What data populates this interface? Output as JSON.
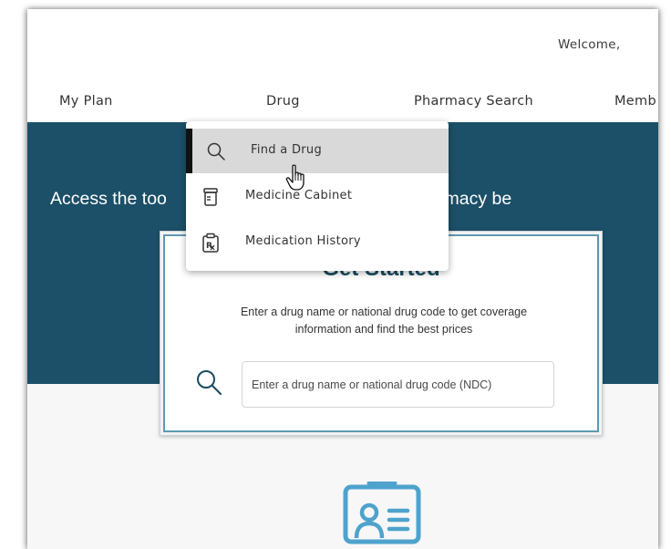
{
  "header": {
    "welcome_text": "Welcome,"
  },
  "nav": {
    "items": [
      "My Plan",
      "Drug",
      "Pharmacy Search",
      "Memb"
    ]
  },
  "dropdown": {
    "items": [
      {
        "label": "Find a Drug",
        "icon": "search-icon",
        "active": true
      },
      {
        "label": "Medicine Cabinet",
        "icon": "pill-bottle-icon",
        "active": false
      },
      {
        "label": "Medication History",
        "icon": "prescription-clipboard-icon",
        "active": false
      }
    ]
  },
  "hero": {
    "text_left": "Access the too",
    "text_right": "st of your pharmacy be"
  },
  "card": {
    "title": "Get Started",
    "description": "Enter a drug name or national drug code to get coverage information and find the best prices",
    "search_placeholder": "Enter a drug name or national drug code (NDC)"
  },
  "colors": {
    "hero_bg": "#1c5068",
    "card_border": "#5f99b0",
    "icon_accent": "#4ea3cd",
    "dropdown_active_bg": "#d9d9d9"
  }
}
